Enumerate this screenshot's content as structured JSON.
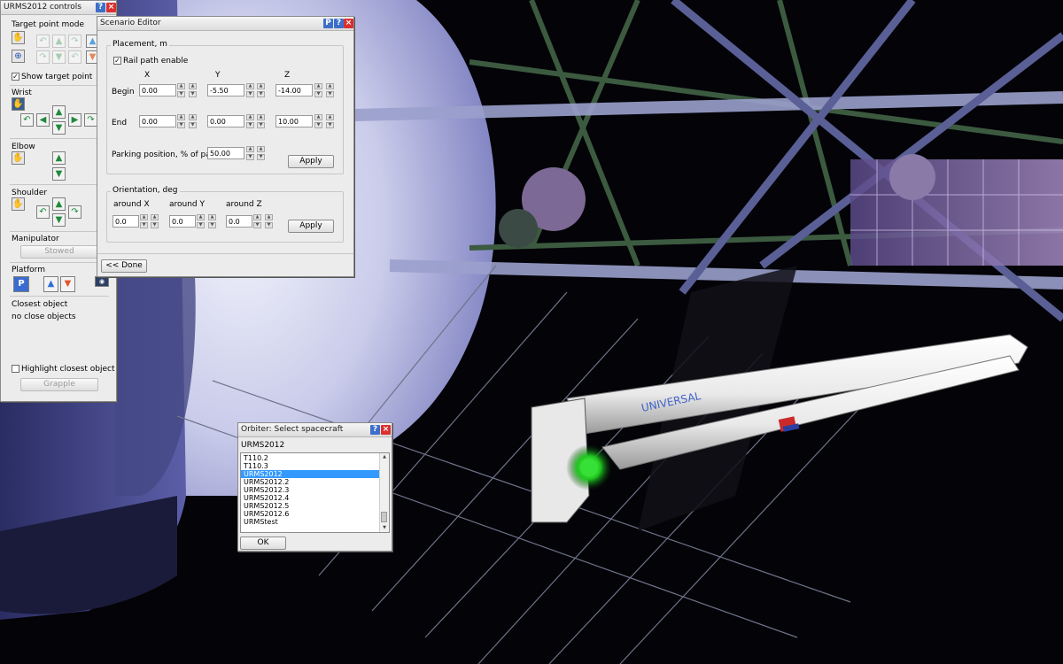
{
  "urms_panel": {
    "title": "URMS2012 controls",
    "target_mode_label": "Target point mode",
    "show_target_label": "Show target point",
    "show_target_checked": true,
    "wrist_label": "Wrist",
    "elbow_label": "Elbow",
    "shoulder_label": "Shoulder",
    "manipulator_label": "Manipulator",
    "stowed_label": "Stowed",
    "platform_label": "Platform",
    "platform_p": "P",
    "closest_label": "Closest object",
    "closest_value": "no close objects",
    "highlight_label": "Highlight closest object",
    "highlight_checked": false,
    "grapple_label": "Grapple"
  },
  "scenario_editor": {
    "title": "Scenario Editor",
    "placement_title": "Placement, m",
    "rail_path_label": "Rail path enable",
    "rail_path_checked": true,
    "col_x": "X",
    "col_y": "Y",
    "col_z": "Z",
    "begin_label": "Begin",
    "begin": {
      "x": "0.00",
      "y": "-5.50",
      "z": "-14.00"
    },
    "end_label": "End",
    "end": {
      "x": "0.00",
      "y": "0.00",
      "z": "10.00"
    },
    "parking_label": "Parking position, % of path",
    "parking_value": "50.00",
    "apply_label": "Apply",
    "orientation_title": "Orientation, deg",
    "around_x_label": "around X",
    "around_y_label": "around Y",
    "around_z_label": "around Z",
    "around_x": "0.0",
    "around_y": "0.0",
    "around_z": "0.0",
    "apply2_label": "Apply",
    "done_label": "<< Done"
  },
  "select_dialog": {
    "title": "Orbiter: Select spacecraft",
    "current": "URMS2012",
    "items": [
      "T110.2",
      "T110.3",
      "URMS2012",
      "URMS2012.2",
      "URMS2012.3",
      "URMS2012.4",
      "URMS2012.5",
      "URMS2012.6",
      "URMStest"
    ],
    "selected_index": 2,
    "ok_label": "OK"
  },
  "scene": {
    "logo_text": "UNIVERSAL"
  },
  "colors": {
    "selection": "#3399ff",
    "close_button": "#d93030",
    "help_button": "#3d6fc9",
    "arrow_green": "#1f8a3a"
  }
}
